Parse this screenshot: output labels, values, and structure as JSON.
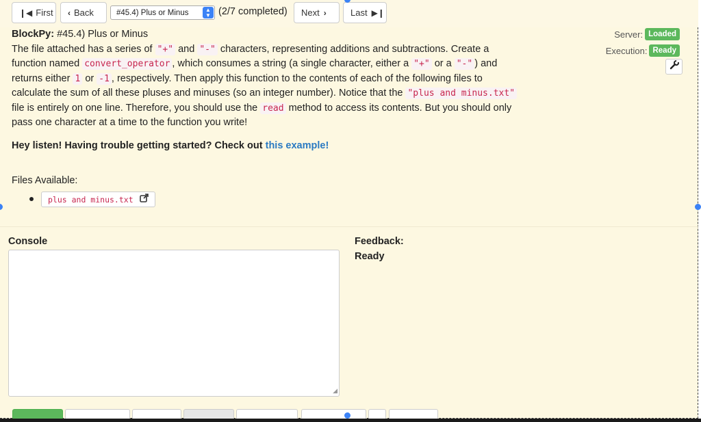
{
  "nav": {
    "first_label": "First",
    "back_label": "Back",
    "assignment_select_value": "#45.4) Plus or Minus",
    "completed_text": "(2/7 completed)",
    "next_label": "Next",
    "last_label": "Last"
  },
  "problem": {
    "title_prefix": "BlockPy:",
    "title_text": "#45.4) Plus or Minus",
    "d1": "The file attached has a series of ",
    "c_plus": "\"+\"",
    "d2": " and ",
    "c_minus": "\"-\"",
    "d3": " characters, representing additions and subtractions. Create a function named ",
    "c_func": "convert_operator",
    "d4": ", which consumes a string (a single character, either a ",
    "c_plus2": "\"+\"",
    "d5": " or a ",
    "c_minus2": "\"-\"",
    "d6": ") and returns either ",
    "c_one": "1",
    "d7": " or ",
    "c_neg": "-1",
    "d8": ", respectively. Then apply this function to the contents of each of the following files to calculate the sum of all these pluses and minuses (so an integer number). Notice that the ",
    "c_file": "\"plus and minus.txt\"",
    "d9": " file is entirely on one line. Therefore, you should use the ",
    "c_read": "read",
    "d10": " method to access its contents. But you should only pass one character at a time to the function you write!",
    "hey_text": "Hey listen! Having trouble getting started? Check out ",
    "hey_link": "this example!"
  },
  "files": {
    "label": "Files Available:",
    "items": [
      "plus and minus.txt"
    ]
  },
  "status": {
    "server_label": "Server:",
    "server_value": "Loaded",
    "execution_label": "Execution:",
    "execution_value": "Ready"
  },
  "console": {
    "label": "Console"
  },
  "feedback": {
    "label": "Feedback:",
    "value": "Ready"
  },
  "colors": {
    "accent_green": "#5cb85c",
    "link_blue": "#2a7ac2",
    "code_red": "#c7254e",
    "panel_bg": "#fdf8e1"
  }
}
